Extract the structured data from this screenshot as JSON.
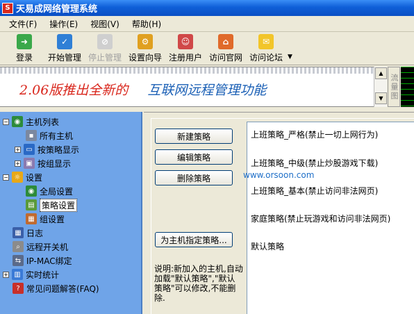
{
  "window": {
    "title": "天易成网络管理系统"
  },
  "menu": [
    "文件(F)",
    "操作(E)",
    "视图(V)",
    "帮助(H)"
  ],
  "toolbar": [
    {
      "label": "登录",
      "icon": "login-icon",
      "enabled": true
    },
    {
      "label": "开始管理",
      "icon": "start-check-icon",
      "enabled": true
    },
    {
      "label": "停止管理",
      "icon": "stop-icon",
      "enabled": false
    },
    {
      "label": "设置向导",
      "icon": "wizard-icon",
      "enabled": true
    },
    {
      "label": "注册用户",
      "icon": "register-user-icon",
      "enabled": true
    },
    {
      "label": "访问官网",
      "icon": "home-icon",
      "enabled": true
    },
    {
      "label": "访问论坛",
      "icon": "forum-icon",
      "enabled": true
    }
  ],
  "banner": {
    "part1": "2.06版推出全新的",
    "part2": "互联网远程管理功能"
  },
  "side": {
    "meter_label": "流量图"
  },
  "tree": [
    "主机列表",
    "所有主机",
    "按策略显示",
    "按组显示",
    "设置",
    "全局设置",
    "策略设置",
    "组设置",
    "日志",
    "远程开关机",
    "IP-MAC绑定",
    "实时统计",
    "常见问题解答(FAQ)"
  ],
  "buttons": {
    "new": "新建策略",
    "edit": "编辑策略",
    "delete": "删除策略",
    "assign": "为主机指定策略..."
  },
  "policies": [
    "上班策略_严格(禁止一切上网行为)",
    "上班策略_中级(禁止炒股游戏下载)",
    "上班策略_基本(禁止访问非法网页)",
    "家庭策略(禁止玩游戏和访问非法网页)",
    "默认策略"
  ],
  "watermark": "www.orsoon.com",
  "note": "说明:新加入的主机,自动加载\"默认策略\",\"默认策略\"可以修改,不能删除.",
  "colors": {
    "titlebar": "#0a54d6",
    "tree_bg": "#6fa4e8",
    "banner_red": "#d9261c",
    "banner_blue": "#1a5fb5"
  }
}
